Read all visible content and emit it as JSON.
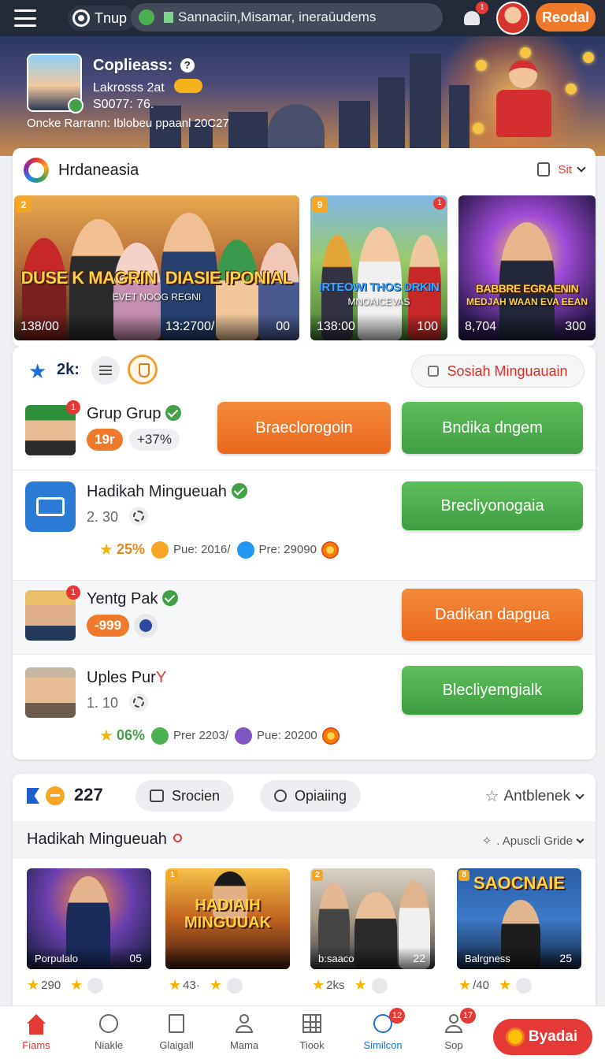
{
  "topbar": {
    "brand": "Tnup",
    "search_value": "Sannaciin,Misamar, ineraūudems",
    "bell_badge": "1",
    "action_button": "Reodal"
  },
  "hero": {
    "name": "Coplieass:",
    "help": "?",
    "line2": "Lakrosss 2at",
    "line3": "S0077: 76.",
    "line4": "Oncke Rarrann: Iblobeu ppaanl  20C27"
  },
  "featured": {
    "title": "Hrdaneasia",
    "sort_label": "Sit",
    "thumbs": [
      {
        "rank": "2",
        "badge": "",
        "caption": "DUSE K MAGRIN",
        "caption2": "DIASIE IPONIAL",
        "sub": "EVET NOOG   REGNI",
        "left": "138/00",
        "mid": "13:2700/",
        "right": "00"
      },
      {
        "rank": "9",
        "badge": "1",
        "caption": "IRTEOWI THOS DRKIN",
        "caption2": "",
        "sub": "MNOAICEVAS",
        "left": "138:00",
        "mid": "",
        "right": "100"
      },
      {
        "rank": "",
        "badge": "",
        "caption": "BABBRE EGRAENIN",
        "caption2": "",
        "sub": "MEDJAH WAAN EVA EEAN",
        "left": "8,704",
        "mid": "",
        "right": "300"
      }
    ]
  },
  "ranking": {
    "count_label": "2k:",
    "header_button": "Sosiah Minguauain",
    "rows": [
      {
        "name": "Grup Grup",
        "badge": "1",
        "pill_orange": "19r",
        "pill_gray": "+37%",
        "buttons": [
          "Braeclorogoin",
          "Bndika dngem"
        ]
      },
      {
        "name": "Hadikah Mingueuah",
        "sub": "2. 30",
        "pct": "25%",
        "stat1": "Pue: 2016/",
        "stat2": "Pre: 29090",
        "buttons": [
          "Brecliyonogaia"
        ]
      },
      {
        "name": "Yentg Pak",
        "badge": "1",
        "pill_orange": "-999",
        "buttons": [
          "Dadikan dapgua"
        ]
      },
      {
        "name": "Uples Pur",
        "suffix": "Y",
        "sub": "1. 10",
        "pct": "06%",
        "stat1": "Prer 2203/",
        "stat2": "Pue: 20200",
        "buttons": [
          "Blecliyemgialk"
        ]
      }
    ]
  },
  "panel": {
    "count": "227",
    "chip1": "Srocien",
    "chip2": "Opiaiing",
    "dropdown": "Antblenek",
    "section_title": "Hadikah Mingueuah",
    "section_option": ". Apuscli Gride",
    "minis": [
      {
        "rank": "",
        "caption": "",
        "left": "Porpulalo",
        "right": "05",
        "stat": "290"
      },
      {
        "rank": "1",
        "caption": "HADIAIH MINGUUAK",
        "left": "",
        "right": "",
        "stat": "43·"
      },
      {
        "rank": "2",
        "caption": "",
        "left": "b:saaco",
        "right": "22",
        "stat": "2ks"
      },
      {
        "rank": "8",
        "caption": "SAOCNAIE",
        "left": "Balrgness",
        "right": "25",
        "stat": "/40"
      }
    ]
  },
  "nav": {
    "items": [
      "Fiams",
      "Niakle",
      "Glaigall",
      "Mama",
      "Tiook",
      "Similcon",
      "Sop"
    ],
    "badges": {
      "similcon": "12",
      "sop": "17"
    },
    "action": "Byadai"
  },
  "colors": {
    "accent_orange": "#f07a2b",
    "accent_green": "#4cae4c",
    "accent_red": "#e53935",
    "topbar": "#232a38"
  }
}
